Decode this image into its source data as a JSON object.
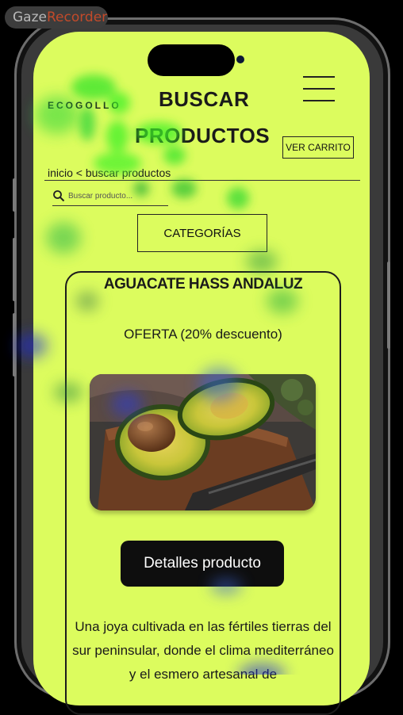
{
  "overlay": {
    "brand_part1": "Gaze",
    "brand_part2": "Recorder"
  },
  "header": {
    "logo": "ECOGOLLO",
    "title_line1": "BUSCAR",
    "title_line2": "PRODUCTOS",
    "cart_label": "VER CARRITO",
    "menu_icon": "hamburger-menu-icon"
  },
  "breadcrumb": "inicio < buscar productos",
  "search": {
    "placeholder": "Buscar producto..."
  },
  "categories_label": "CATEGORÍAS",
  "product": {
    "name": "AGUACATE HASS ANDALUZ",
    "offer": "OFERTA (20% descuento)",
    "image": "avocado-halves-on-cutting-board",
    "details_label": "Detalles producto",
    "description": "Una joya cultivada en las fértiles tierras del sur peninsular, donde el clima mediterráneo y el esmero artesanal de"
  },
  "colors": {
    "screen_bg": "#dcfc5e",
    "button_dark": "#0e0e0e",
    "text": "#1a1a1a"
  }
}
